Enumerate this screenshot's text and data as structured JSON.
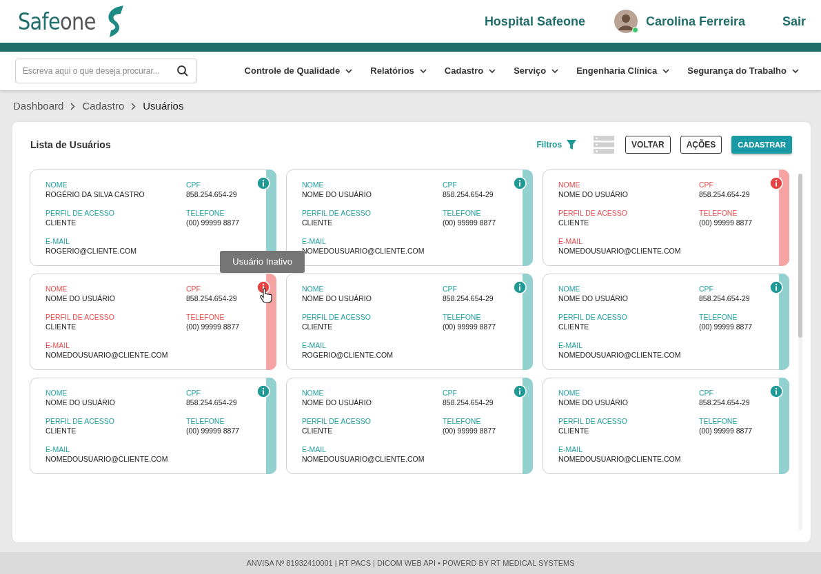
{
  "header": {
    "logo": {
      "part_1": "Safe",
      "part_2": "one"
    },
    "hospital": "Hospital Safeone",
    "user": {
      "name": "Carolina Ferreira",
      "online": true
    },
    "logout": "Sair"
  },
  "search": {
    "placeholder": "Escreva aqui o que deseja procurar..."
  },
  "menu": [
    {
      "label": "Controle de Qualidade"
    },
    {
      "label": "Relatórios"
    },
    {
      "label": "Cadastro"
    },
    {
      "label": "Serviço"
    },
    {
      "label": "Engenharia Clínica"
    },
    {
      "label": "Segurança do Trabalho"
    }
  ],
  "breadcrumb": [
    "Dashboard",
    "Cadastro",
    "Usuários"
  ],
  "panel": {
    "title": "Lista de Usuários",
    "filters": "Filtros",
    "buttons": [
      {
        "label": "VOLTAR",
        "kind": "outline"
      },
      {
        "label": "AÇÕES",
        "kind": "outline"
      },
      {
        "label": "CADASTRAR",
        "kind": "primary"
      }
    ]
  },
  "cards": [
    {
      "active": true,
      "fields": [
        {
          "label": "NOME",
          "value": "ROGÉRIO DA SILVA CASTRO"
        },
        {
          "label": "CPF",
          "value": "858.254.654-29"
        },
        {
          "label": "PERFIL DE ACESSO",
          "value": "CLIENTE"
        },
        {
          "label": "TELEFONE",
          "value": "(00) 99999 8877"
        },
        {
          "label": "E-MAIL",
          "value": "ROGERIO@CLIENTE.COM"
        }
      ]
    },
    {
      "active": true,
      "fields": [
        {
          "label": "NOME",
          "value": "NOME DO USUÁRIO"
        },
        {
          "label": "CPF",
          "value": "858.254.654-29"
        },
        {
          "label": "PERFIL DE ACESSO",
          "value": "CLIENTE"
        },
        {
          "label": "TELEFONE",
          "value": "(00) 99999 8877"
        },
        {
          "label": "E-MAIL",
          "value": "NOMEDOUSUARIO@CLIENTE.COM"
        }
      ]
    },
    {
      "active": false,
      "fields": [
        {
          "label": "NOME",
          "value": "NOME DO USUÁRIO"
        },
        {
          "label": "CPF",
          "value": "858.254.654-29"
        },
        {
          "label": "PERFIL DE ACESSO",
          "value": "CLIENTE"
        },
        {
          "label": "TELEFONE",
          "value": "(00) 99999 8877"
        },
        {
          "label": "E-MAIL",
          "value": "NOMEDOUSUARIO@CLIENTE.COM"
        }
      ]
    },
    {
      "active": false,
      "tooltip": "Usuário Inativo",
      "fields": [
        {
          "label": "NOME",
          "value": "NOME DO USUÁRIO"
        },
        {
          "label": "CPF",
          "value": "858.254.654-29"
        },
        {
          "label": "PERFIL DE ACESSO",
          "value": "CLIENTE"
        },
        {
          "label": "TELEFONE",
          "value": "(00) 99999 8877"
        },
        {
          "label": "E-MAIL",
          "value": "NOMEDOUSUARIO@CLIENTE.COM"
        }
      ]
    },
    {
      "active": true,
      "fields": [
        {
          "label": "NOME",
          "value": "NOME DO USUÁRIO"
        },
        {
          "label": "CPF",
          "value": "858.254.654-29"
        },
        {
          "label": "PERFIL DE ACESSO",
          "value": "CLIENTE"
        },
        {
          "label": "TELEFONE",
          "value": "(00) 99999 8877"
        },
        {
          "label": "E-MAIL",
          "value": "ROGERIO@CLIENTE.COM"
        }
      ]
    },
    {
      "active": true,
      "fields": [
        {
          "label": "NOME",
          "value": "NOME DO USUÁRIO"
        },
        {
          "label": "CPF",
          "value": "858.254.654-29"
        },
        {
          "label": "PERFIL DE ACESSO",
          "value": "CLIENTE"
        },
        {
          "label": "TELEFONE",
          "value": "(00) 99999 8877"
        },
        {
          "label": "E-MAIL",
          "value": "NOMEDOUSUARIO@CLIENTE.COM"
        }
      ]
    },
    {
      "active": true,
      "fields": [
        {
          "label": "NOME",
          "value": "NOME DO USUÁRIO"
        },
        {
          "label": "CPF",
          "value": "858.254.654-29"
        },
        {
          "label": "PERFIL DE ACESSO",
          "value": "CLIENTE"
        },
        {
          "label": "TELEFONE",
          "value": "(00) 99999 8877"
        },
        {
          "label": "E-MAIL",
          "value": "NOMEDOUSUARIO@CLIENTE.COM"
        }
      ]
    },
    {
      "active": true,
      "fields": [
        {
          "label": "NOME",
          "value": "NOME DO USUÁRIO"
        },
        {
          "label": "CPF",
          "value": "858.254.654-29"
        },
        {
          "label": "PERFIL DE ACESSO",
          "value": "CLIENTE"
        },
        {
          "label": "TELEFONE",
          "value": "(00) 99999 8877"
        },
        {
          "label": "E-MAIL",
          "value": "NOMEDOUSUARIO@CLIENTE.COM"
        }
      ]
    },
    {
      "active": true,
      "fields": [
        {
          "label": "NOME",
          "value": "NOME DO USUÁRIO"
        },
        {
          "label": "CPF",
          "value": "858.254.654-29"
        },
        {
          "label": "PERFIL DE ACESSO",
          "value": "CLIENTE"
        },
        {
          "label": "TELEFONE",
          "value": "(00) 99999 8877"
        },
        {
          "label": "E-MAIL",
          "value": "NOMEDOUSUARIO@CLIENTE.COM"
        }
      ]
    }
  ],
  "footer": "ANVISA Nº 81932410001 | RT PACS | DICOM WEB API • POWERD BY RT MEDICAL SYSTEMS"
}
